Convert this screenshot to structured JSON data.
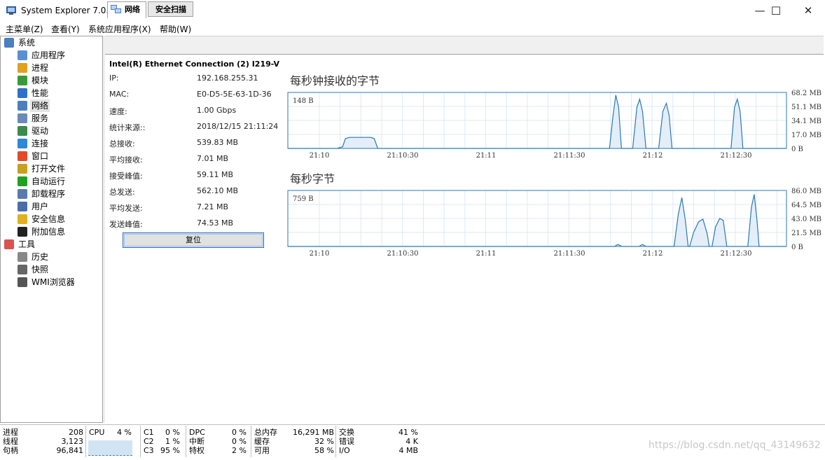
{
  "window": {
    "title": "System Explorer 7.0.0.5356",
    "minimize_glyph": "—",
    "maximize_glyph": "☐",
    "close_glyph": "✕"
  },
  "menu": [
    "主菜单(Z)",
    "查看(Y)",
    "系统应用程序(X)",
    "帮助(W)"
  ],
  "tree": {
    "root1": "系统",
    "items": [
      {
        "label": "应用程序",
        "icon": "applications-icon",
        "color": "#5b8fd4"
      },
      {
        "label": "进程",
        "icon": "processes-gear-icon",
        "color": "#e0a020"
      },
      {
        "label": "模块",
        "icon": "modules-icon",
        "color": "#3a9a3a"
      },
      {
        "label": "性能",
        "icon": "performance-icon",
        "color": "#2f70c8"
      },
      {
        "label": "网络",
        "icon": "network-icon",
        "color": "#4a7fc0",
        "selected": true
      },
      {
        "label": "服务",
        "icon": "services-icon",
        "color": "#6a8ab8"
      },
      {
        "label": "驱动",
        "icon": "drivers-icon",
        "color": "#3c8a4c"
      },
      {
        "label": "连接",
        "icon": "connections-globe-icon",
        "color": "#2e88d8"
      },
      {
        "label": "窗口",
        "icon": "windows-logo-icon",
        "color": "#e44a2a"
      },
      {
        "label": "打开文件",
        "icon": "open-files-lock-icon",
        "color": "#c8a020"
      },
      {
        "label": "自动运行",
        "icon": "autorun-arrow-icon",
        "color": "#22a022"
      },
      {
        "label": "卸载程序",
        "icon": "uninstall-icon",
        "color": "#5a7ab0"
      },
      {
        "label": "用户",
        "icon": "users-icon",
        "color": "#4a6fa8"
      },
      {
        "label": "安全信息",
        "icon": "security-shield-icon",
        "color": "#e0b020"
      },
      {
        "label": "附加信息",
        "icon": "info-icon",
        "color": "#222222"
      }
    ],
    "root2": "工具",
    "tools": [
      {
        "label": "历史",
        "icon": "history-clock-icon",
        "color": "#888888"
      },
      {
        "label": "快照",
        "icon": "snapshot-camera-icon",
        "color": "#666666"
      },
      {
        "label": "WMI浏览器",
        "icon": "wmi-browser-icon",
        "color": "#555555"
      }
    ]
  },
  "tabs": {
    "network": "网络",
    "security": "安全扫描"
  },
  "adapter": {
    "name": "Intel(R) Ethernet Connection (2) I219-V",
    "fields": [
      {
        "label": "IP:",
        "value": "192.168.255.31"
      },
      {
        "label": "MAC:",
        "value": "E0-D5-5E-63-1D-36"
      },
      {
        "label": "速度:",
        "value": "1.00 Gbps"
      },
      {
        "label": "统计来源::",
        "value": "2018/12/15 21:11:24"
      },
      {
        "label": "总接收:",
        "value": "539.83 MB"
      },
      {
        "label": "平均接收:",
        "value": "7.01 MB"
      },
      {
        "label": "接受峰值:",
        "value": "59.11 MB"
      },
      {
        "label": "总发送:",
        "value": "562.10 MB"
      },
      {
        "label": "平均发送:",
        "value": "7.21 MB"
      },
      {
        "label": "发送峰值:",
        "value": "74.53 MB"
      }
    ],
    "reset_label": "复位"
  },
  "chart_data": [
    {
      "type": "area",
      "title": "每秒钟接收的字节",
      "current_label": "148 B",
      "x_ticks": [
        "21:10",
        "21:10:30",
        "21:11",
        "21:11:30",
        "21:12",
        "21:12:30"
      ],
      "y_ticks": [
        "68.2 MB",
        "51.1 MB",
        "34.1 MB",
        "17.0 MB",
        "0 B"
      ],
      "ylim": [
        0,
        68.2
      ],
      "y_unit": "MB",
      "grid": true,
      "points": [
        [
          0,
          0
        ],
        [
          70,
          0
        ],
        [
          78,
          2
        ],
        [
          82,
          12
        ],
        [
          88,
          13.5
        ],
        [
          118,
          13.5
        ],
        [
          123,
          12
        ],
        [
          128,
          0
        ],
        [
          458,
          0
        ],
        [
          463,
          40
        ],
        [
          467,
          65
        ],
        [
          471,
          50
        ],
        [
          475,
          0
        ],
        [
          491,
          0
        ],
        [
          497,
          50
        ],
        [
          501,
          60
        ],
        [
          505,
          45
        ],
        [
          510,
          0
        ],
        [
          528,
          0
        ],
        [
          534,
          45
        ],
        [
          539,
          55
        ],
        [
          543,
          40
        ],
        [
          547,
          0
        ],
        [
          631,
          0
        ],
        [
          636,
          50
        ],
        [
          640,
          60
        ],
        [
          644,
          45
        ],
        [
          648,
          0
        ],
        [
          710,
          0
        ]
      ],
      "color": "#2a7ab5"
    },
    {
      "type": "area",
      "title": "每秒字节",
      "current_label": "759 B",
      "x_ticks": [
        "21:10",
        "21:10:30",
        "21:11",
        "21:11:30",
        "21:12",
        "21:12:30"
      ],
      "y_ticks": [
        "86.0 MB",
        "64.5 MB",
        "43.0 MB",
        "21.5 MB",
        "0 B"
      ],
      "ylim": [
        0,
        86.0
      ],
      "y_unit": "MB",
      "grid": true,
      "points": [
        [
          0,
          0
        ],
        [
          465,
          0
        ],
        [
          470,
          3
        ],
        [
          476,
          0
        ],
        [
          500,
          0
        ],
        [
          505,
          3
        ],
        [
          510,
          0
        ],
        [
          550,
          0
        ],
        [
          556,
          50
        ],
        [
          561,
          75
        ],
        [
          566,
          40
        ],
        [
          570,
          0
        ],
        [
          572,
          0
        ],
        [
          578,
          22
        ],
        [
          585,
          38
        ],
        [
          591,
          42
        ],
        [
          597,
          20
        ],
        [
          600,
          0
        ],
        [
          604,
          0
        ],
        [
          609,
          30
        ],
        [
          615,
          43
        ],
        [
          620,
          40
        ],
        [
          625,
          0
        ],
        [
          655,
          0
        ],
        [
          660,
          60
        ],
        [
          664,
          80
        ],
        [
          668,
          40
        ],
        [
          671,
          0
        ],
        [
          710,
          0
        ]
      ],
      "color": "#2a7ab5"
    }
  ],
  "status": {
    "processes_label": "进程",
    "processes": "208",
    "threads_label": "线程",
    "threads": "3,123",
    "handles_label": "句柄",
    "handles": "96,841",
    "cpu_label": "CPU",
    "cpu": "4 %",
    "c1_label": "C1",
    "c1": "0 %",
    "c2_label": "C2",
    "c2": "1 %",
    "c3_label": "C3",
    "c3": "95 %",
    "dpc_label": "DPC",
    "dpc": "0 %",
    "interrupt_label": "中断",
    "interrupt": "0 %",
    "privileged_label": "特权",
    "privileged": "2 %",
    "total_mem_label": "总内存",
    "total_mem": "16,291 MB",
    "cache_label": "缓存",
    "cache": "32 %",
    "available_label": "可用",
    "available": "58 %",
    "swap_label": "交换",
    "swap": "41 %",
    "errors_label": "错误",
    "errors": "4 K",
    "io_label": "I/O",
    "io": "4 MB"
  },
  "watermark": "https://blog.csdn.net/qq_43149632"
}
